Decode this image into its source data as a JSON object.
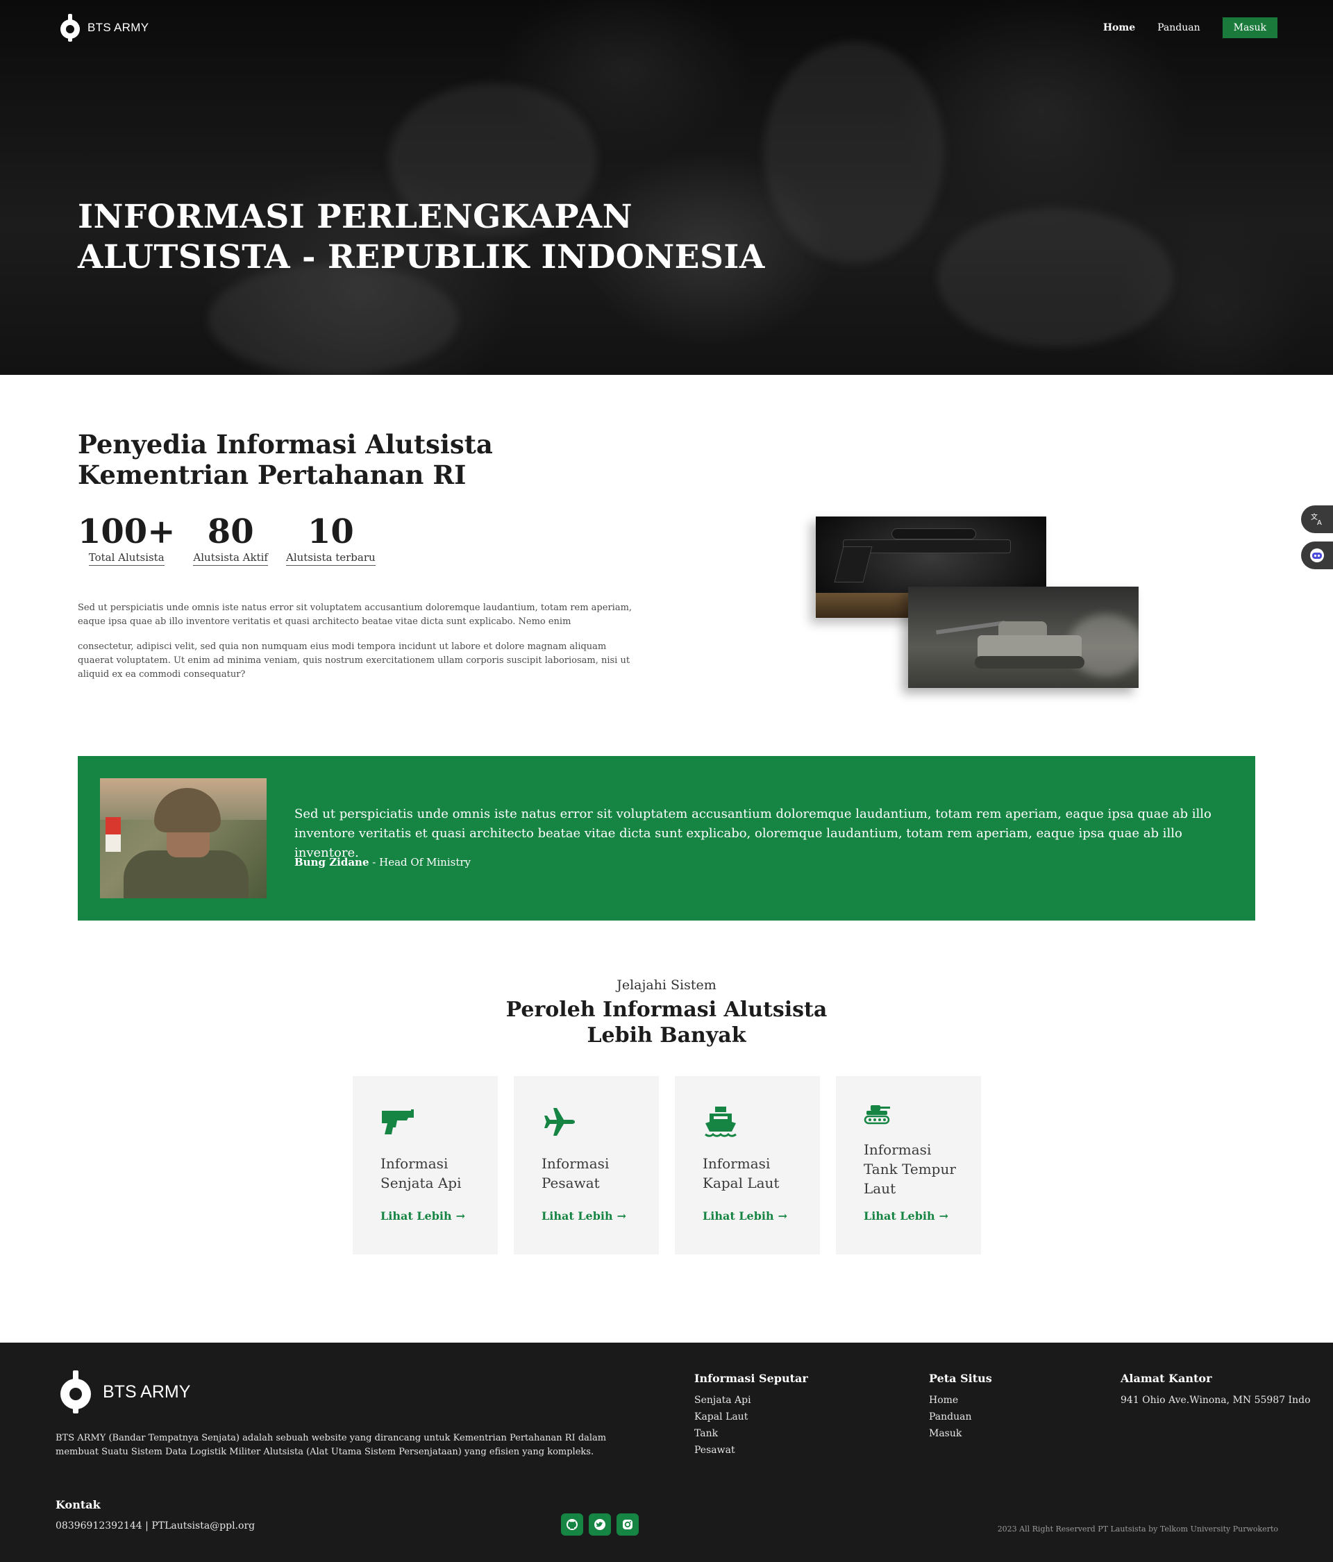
{
  "brand": {
    "name": "BTS ARMY"
  },
  "nav": {
    "home": "Home",
    "guide": "Panduan",
    "login": "Masuk"
  },
  "hero": {
    "title_line1": "INFORMASI PERLENGKAPAN",
    "title_line2": "ALUTSISTA - REPUBLIK INDONESIA"
  },
  "about": {
    "title_line1": "Penyedia Informasi Alutsista",
    "title_line2": "Kementrian Pertahanan RI",
    "stats": [
      {
        "value": "100+",
        "label": "Total Alutsista"
      },
      {
        "value": "80",
        "label": "Alutsista Aktif"
      },
      {
        "value": "10",
        "label": "Alutsista terbaru"
      }
    ],
    "paragraph1": "Sed ut perspiciatis unde omnis iste natus error sit voluptatem accusantium doloremque laudantium, totam rem aperiam, eaque ipsa quae ab illo inventore veritatis et quasi architecto beatae vitae dicta sunt explicabo. Nemo enim",
    "paragraph2": "consectetur, adipisci velit, sed quia non numquam eius modi tempora incidunt ut labore et dolore magnam aliquam quaerat voluptatem. Ut enim ad minima veniam, quis nostrum exercitationem ullam corporis suscipit laboriosam, nisi ut aliquid ex ea commodi consequatur?"
  },
  "quote": {
    "text": "Sed ut perspiciatis unde omnis iste natus error sit voluptatem accusantium doloremque laudantium, totam rem aperiam, eaque ipsa quae ab illo inventore veritatis et quasi architecto beatae vitae dicta sunt explicabo, oloremque laudantium, totam rem aperiam, eaque ipsa quae ab illo inventore.",
    "author_name": "Bung Zidane",
    "author_role": "- Head Of Ministry"
  },
  "explore": {
    "subtitle": "Jelajahi Sistem",
    "title_line1": "Peroleh Informasi Alutsista",
    "title_line2": "Lebih Banyak",
    "cards": [
      {
        "icon": "gun-icon",
        "title": "Informasi Senjata Api",
        "link": "Lihat Lebih"
      },
      {
        "icon": "plane-icon",
        "title": "Informasi Pesawat",
        "link": "Lihat Lebih"
      },
      {
        "icon": "ship-icon",
        "title": "Informasi Kapal Laut",
        "link": "Lihat Lebih"
      },
      {
        "icon": "tank-icon",
        "title": "Informasi Tank Tempur Laut",
        "link": "Lihat Lebih"
      }
    ]
  },
  "footer": {
    "description": "BTS ARMY (Bandar Tempatnya Senjata) adalah sebuah website yang dirancang untuk Kementrian Pertahanan RI dalam membuat Suatu Sistem Data Logistik Militer Alutsista (Alat Utama Sistem Persenjataan) yang efisien yang kompleks.",
    "info": {
      "heading": "Informasi Seputar",
      "items": [
        "Senjata Api",
        "Kapal Laut",
        "Tank",
        "Pesawat"
      ]
    },
    "sitemap": {
      "heading": "Peta Situs",
      "items": [
        "Home",
        "Panduan",
        "Masuk"
      ]
    },
    "office": {
      "heading": "Alamat Kantor",
      "address": "941 Ohio Ave.Winona, MN 55987 Indo"
    },
    "contact": {
      "heading": "Kontak",
      "value": "08396912392144 | PTLautsista@ppl.org"
    },
    "socials": [
      "github-icon",
      "twitter-icon",
      "instagram-icon"
    ],
    "copyright": "2023 All Right Reserverd PT Lautsista by Telkom University Purwokerto"
  },
  "floating": [
    "translate-icon",
    "chat-bot-icon"
  ],
  "colors": {
    "accent": "#168443",
    "footer_bg": "#1a1a1a",
    "card_bg": "#f4f4f4"
  }
}
